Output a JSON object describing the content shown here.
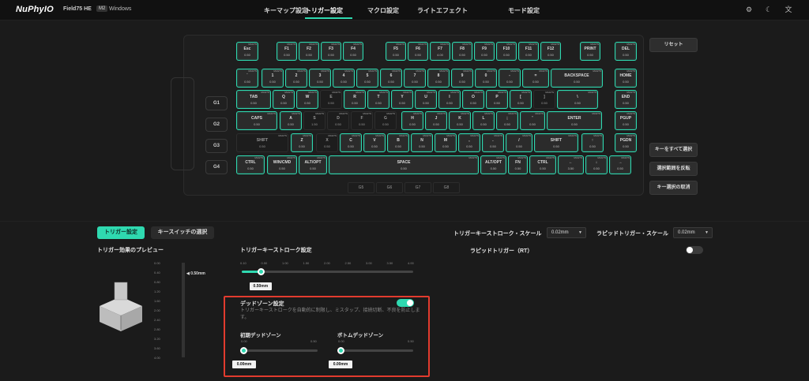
{
  "header": {
    "logo": "NuPhyIO",
    "model": "Field75 HE",
    "profile": "M2",
    "os": "Windows",
    "nav": [
      "キーマップ設定",
      "トリガー設定",
      "マクロ設定",
      "ライトエフェクト",
      "モード設定"
    ],
    "icons": [
      "gear-icon",
      "moon-icon",
      "language-icon"
    ]
  },
  "accent": "#2fd9b0",
  "keyboard": {
    "groups": [
      "G1",
      "G2",
      "G3",
      "G4"
    ],
    "layers": [
      "G5",
      "G6",
      "G7",
      "G8"
    ],
    "rows": [
      [
        [
          "Esc",
          "0.50"
        ],
        [
          "F1",
          "0.50"
        ],
        [
          "F2",
          "0.50"
        ],
        [
          "F3",
          "0.50"
        ],
        [
          "F4",
          "0.50"
        ],
        [
          "F5",
          "0.50"
        ],
        [
          "F6",
          "0.50"
        ],
        [
          "F7",
          "4.00"
        ],
        [
          "F8",
          "0.50"
        ],
        [
          "F9",
          "0.50"
        ],
        [
          "F10",
          "0.50"
        ],
        [
          "F11",
          "0.50"
        ],
        [
          "F12",
          "0.50"
        ],
        [
          "PRINT",
          "0.50"
        ],
        [
          "DEL",
          "0.50"
        ]
      ],
      [
        [
          "`",
          "0.50"
        ],
        [
          "1",
          "0.50"
        ],
        [
          "2",
          "0.50"
        ],
        [
          "3",
          "0.50"
        ],
        [
          "4",
          "0.50"
        ],
        [
          "5",
          "0.50"
        ],
        [
          "6",
          "0.50"
        ],
        [
          "7",
          "0.50"
        ],
        [
          "8",
          "0.50"
        ],
        [
          "9",
          "0.50"
        ],
        [
          "0",
          "0.50"
        ],
        [
          "-",
          "0.50"
        ],
        [
          "=",
          "0.50"
        ],
        [
          "BACKSPACE",
          "0.50"
        ],
        [
          "HOME",
          "0.50"
        ]
      ],
      [
        [
          "TAB",
          "0.50"
        ],
        [
          "Q",
          "0.50"
        ],
        [
          "W",
          "0.50"
        ],
        [
          "E",
          "0.50"
        ],
        [
          "R",
          "0.50"
        ],
        [
          "T",
          "0.50"
        ],
        [
          "Y",
          "0.50"
        ],
        [
          "U",
          "0.50"
        ],
        [
          "I",
          "0.50"
        ],
        [
          "O",
          "0.50"
        ],
        [
          "P",
          "0.50"
        ],
        [
          "[",
          "0.50"
        ],
        [
          "]",
          "0.50"
        ],
        [
          "\\",
          "0.50"
        ],
        [
          "END",
          "0.50"
        ]
      ],
      [
        [
          "CAPS",
          "0.50"
        ],
        [
          "A",
          "0.50"
        ],
        [
          "S",
          "1.50"
        ],
        [
          "D",
          "0.50"
        ],
        [
          "F",
          "0.50"
        ],
        [
          "G",
          "0.50"
        ],
        [
          "H",
          "0.50"
        ],
        [
          "J",
          "0.50"
        ],
        [
          "K",
          "0.50"
        ],
        [
          "L",
          "0.50"
        ],
        [
          ";",
          "0.50"
        ],
        [
          "'",
          "0.50"
        ],
        [
          "ENTER",
          "0.50"
        ],
        [
          "PGUP",
          "0.50"
        ]
      ],
      [
        [
          "SHIFT",
          "0.50"
        ],
        [
          "Z",
          "0.50"
        ],
        [
          "X",
          "0.50"
        ],
        [
          "C",
          "0.50"
        ],
        [
          "V",
          "0.50"
        ],
        [
          "B",
          "0.50"
        ],
        [
          "N",
          "0.50"
        ],
        [
          "M",
          "0.50"
        ],
        [
          ",",
          "0.50"
        ],
        [
          ".",
          "0.50"
        ],
        [
          "/",
          "0.50"
        ],
        [
          "SHIFT",
          "0.50"
        ],
        [
          "↑",
          "0.50"
        ],
        [
          "PGDN",
          "0.50"
        ]
      ],
      [
        [
          "CTRL",
          "0.50"
        ],
        [
          "WIN/CMD",
          "0.50"
        ],
        [
          "ALT/OPT",
          "0.50"
        ],
        [
          "SPACE",
          "0.50"
        ],
        [
          "ALT/OPT",
          "0.50"
        ],
        [
          "FN",
          "0.50"
        ],
        [
          "CTRL",
          "0.50"
        ],
        [
          "←",
          "3.50"
        ],
        [
          "↓",
          "0.50"
        ],
        [
          "→",
          "0.50"
        ]
      ]
    ],
    "key_tag": "MAGTS"
  },
  "right_buttons": {
    "reset": "リセット",
    "select_all": "キーをすべて選択",
    "invert": "選択範囲を反転",
    "deselect": "キー選択の取消"
  },
  "tabs": {
    "trigger": "トリガー設定",
    "switch": "キースイッチの選択"
  },
  "preview": {
    "title": "トリガー効果のプレビュー",
    "value": "0.50mm",
    "scale": [
      "0.00",
      "0.40",
      "0.80",
      "1.20",
      "1.60",
      "2.00",
      "2.40",
      "2.80",
      "3.20",
      "3.60",
      "4.00"
    ]
  },
  "stroke": {
    "title": "トリガーキーストローク設定",
    "scale": [
      "0.10",
      "0.50",
      "1.00",
      "1.50",
      "2.00",
      "2.50",
      "3.00",
      "3.50",
      "4.00"
    ],
    "value": "0.50mm",
    "fraction": 0.11
  },
  "scales": {
    "stroke_scale_label": "トリガーキーストローク・スケール",
    "stroke_scale": "0.02mm",
    "rapid_scale_label": "ラピッドトリガー・スケール",
    "rapid_scale": "0.02mm"
  },
  "rapid": {
    "label": "ラピッドトリガー（RT）",
    "on": false
  },
  "deadzone": {
    "title": "デッドゾーン設定",
    "on": true,
    "desc": "トリガーキーストロークを自動的に制限し、ミスタップ、接続切断、不良を防止します。",
    "initial": {
      "label": "初期デッドゾーン",
      "min": "0.00",
      "max": "0.50",
      "value": "0.00mm",
      "fraction": 0
    },
    "bottom": {
      "label": "ボトムデッドゾーン",
      "min": "0.00",
      "max": "0.50",
      "value": "0.00mm",
      "fraction": 0
    }
  }
}
